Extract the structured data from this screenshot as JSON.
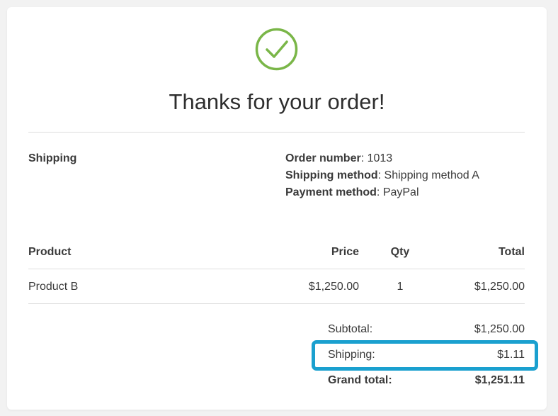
{
  "title": "Thanks for your order!",
  "shipping_heading": "Shipping",
  "meta": [
    {
      "key": "Order number",
      "value": "1013"
    },
    {
      "key": "Shipping method",
      "value": "Shipping method A"
    },
    {
      "key": "Payment method",
      "value": "PayPal"
    }
  ],
  "table": {
    "headers": {
      "product": "Product",
      "price": "Price",
      "qty": "Qty",
      "total": "Total"
    },
    "rows": [
      {
        "product": "Product B",
        "price": "$1,250.00",
        "qty": "1",
        "total": "$1,250.00"
      }
    ]
  },
  "totals": {
    "subtotal_label": "Subtotal:",
    "subtotal_value": "$1,250.00",
    "shipping_label": "Shipping:",
    "shipping_value": "$1.11",
    "grand_label": "Grand total:",
    "grand_value": "$1,251.11"
  },
  "colors": {
    "check": "#7ab648",
    "highlight": "#1aa0cf"
  },
  "icons": {
    "success": "check-circle-icon"
  }
}
